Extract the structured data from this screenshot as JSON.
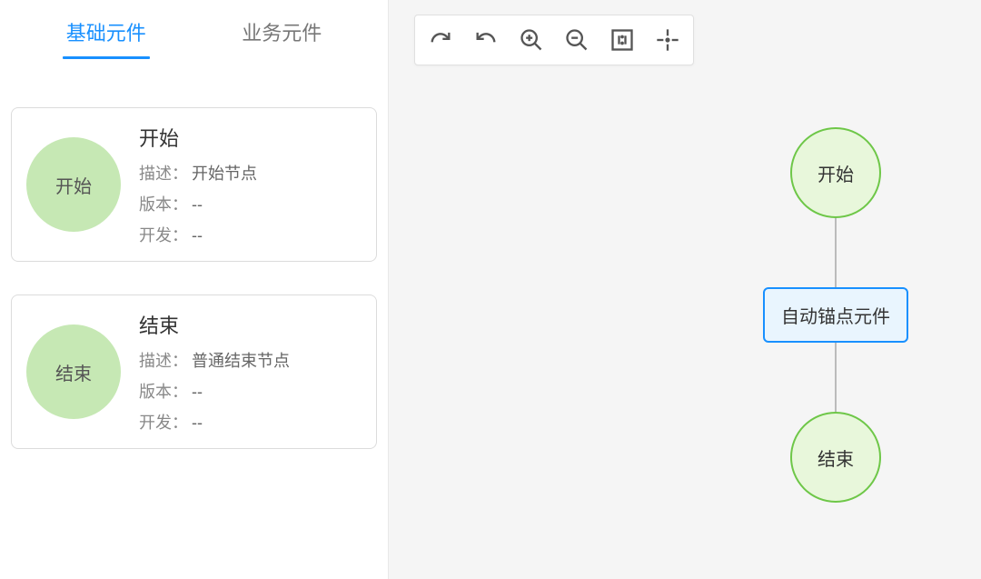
{
  "sidebar": {
    "tabs": [
      {
        "label": "基础元件",
        "active": true
      },
      {
        "label": "业务元件",
        "active": false
      }
    ],
    "components": [
      {
        "circleLabel": "开始",
        "title": "开始",
        "descLabel": "描述：",
        "descValue": "开始节点",
        "versionLabel": "版本：",
        "versionValue": "--",
        "devLabel": "开发：",
        "devValue": "--"
      },
      {
        "circleLabel": "结束",
        "title": "结束",
        "descLabel": "描述：",
        "descValue": "普通结束节点",
        "versionLabel": "版本：",
        "versionValue": "--",
        "devLabel": "开发：",
        "devValue": "--"
      }
    ]
  },
  "toolbar": {
    "icons": [
      "redo",
      "undo",
      "zoom-in",
      "zoom-out",
      "fit-1-1",
      "center"
    ]
  },
  "canvas": {
    "nodes": {
      "start": {
        "label": "开始"
      },
      "autoAnchor": {
        "label": "自动锚点元件"
      },
      "end": {
        "label": "结束"
      }
    }
  }
}
